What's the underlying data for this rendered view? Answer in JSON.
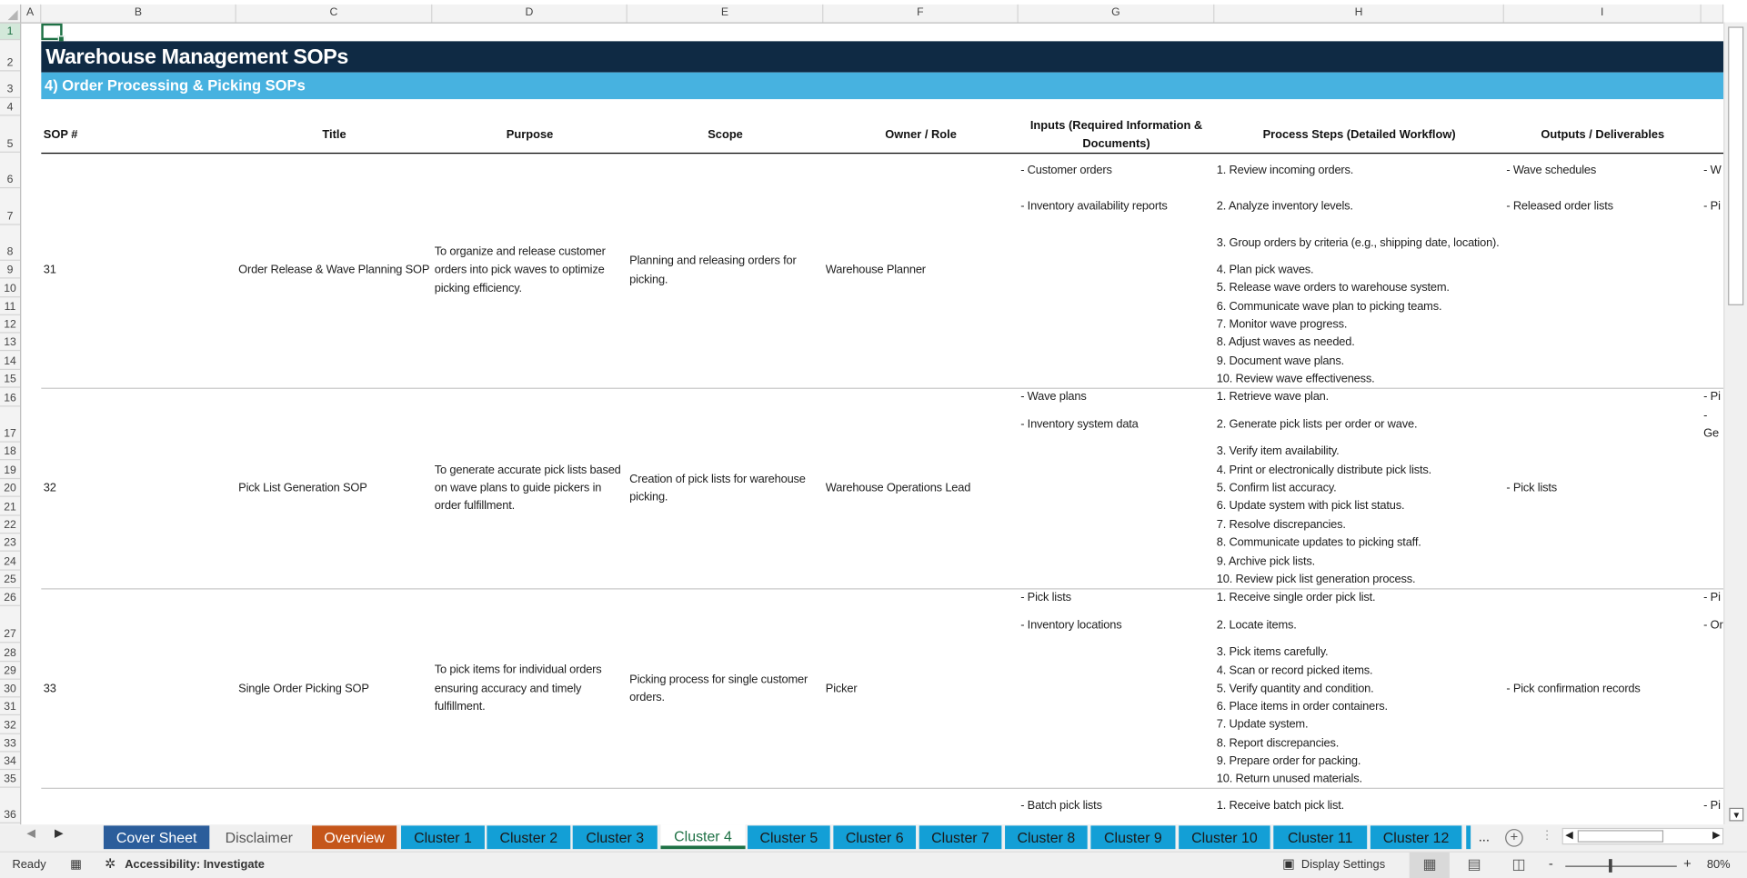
{
  "columns": [
    "A",
    "B",
    "C",
    "D",
    "E",
    "F",
    "G",
    "H",
    "I"
  ],
  "row_numbers": [
    1,
    2,
    3,
    4,
    5,
    6,
    7,
    8,
    9,
    10,
    11,
    12,
    13,
    14,
    15,
    16,
    17,
    18,
    19,
    20,
    21,
    22,
    23,
    24,
    25,
    26,
    27,
    28,
    29,
    30,
    31,
    32,
    33,
    34,
    35,
    36
  ],
  "sheet": {
    "title": "Warehouse Management SOPs",
    "subtitle": "4) Order Processing & Picking SOPs"
  },
  "headers": {
    "sop": "SOP #",
    "title": "Title",
    "purpose": "Purpose",
    "scope": "Scope",
    "owner": "Owner / Role",
    "inputs": "Inputs (Required Information & Documents)",
    "steps": "Process Steps (Detailed Workflow)",
    "outputs": "Outputs / Deliverables"
  },
  "sops": [
    {
      "number": "31",
      "title": "Order Release & Wave Planning SOP",
      "purpose": "To organize and release customer orders into pick waves to optimize picking efficiency.",
      "scope": "Planning and releasing orders for picking.",
      "owner": "Warehouse Planner",
      "inputs": [
        "- Customer orders",
        "- Inventory availability reports"
      ],
      "steps": [
        "1. Review incoming orders.",
        "2. Analyze inventory levels.",
        "3. Group orders by criteria (e.g., shipping date, location).",
        "4. Plan pick waves.",
        "5. Release wave orders to warehouse system.",
        "6. Communicate wave plan to picking teams.",
        "7. Monitor wave progress.",
        "8. Adjust waves as needed.",
        "9. Document wave plans.",
        "10. Review wave effectiveness."
      ],
      "outputs": [
        "- Wave schedules",
        "- Released order lists"
      ],
      "next_col": [
        "- W",
        "- Pi"
      ]
    },
    {
      "number": "32",
      "title": "Pick List Generation SOP",
      "purpose": "To generate accurate pick lists based on wave plans to guide pickers in order fulfillment.",
      "scope": "Creation of pick lists for warehouse picking.",
      "owner": "Warehouse Operations Lead",
      "inputs": [
        "- Wave plans",
        "- Inventory system data"
      ],
      "steps": [
        "1. Retrieve wave plan.",
        "2. Generate pick lists per order or wave.",
        "3. Verify item availability.",
        "4. Print or electronically distribute pick lists.",
        "5. Confirm list accuracy.",
        "6. Update system with pick list status.",
        "7. Resolve discrepancies.",
        "8. Communicate updates to picking staff.",
        "9. Archive pick lists.",
        "10. Review pick list generation process."
      ],
      "outputs": [
        "- Pick lists"
      ],
      "next_col": [
        "- Pi",
        "- Ge"
      ]
    },
    {
      "number": "33",
      "title": "Single Order Picking SOP",
      "purpose": "To pick items for individual orders ensuring accuracy and timely fulfillment.",
      "scope": "Picking process for single customer orders.",
      "owner": "Picker",
      "inputs": [
        "- Pick lists",
        "- Inventory locations"
      ],
      "steps": [
        "1. Receive single order pick list.",
        "2. Locate items.",
        "3. Pick items carefully.",
        "4. Scan or record picked items.",
        "5. Verify quantity and condition.",
        "6. Place items in order containers.",
        "7. Update system.",
        "8. Report discrepancies.",
        "9. Prepare order for packing.",
        "10. Return unused materials."
      ],
      "outputs": [
        "- Pick confirmation records"
      ],
      "next_col": [
        "- Pi",
        "- Or"
      ]
    },
    {
      "inputs": [
        "- Batch pick lists"
      ],
      "steps": [
        "1. Receive batch pick list."
      ],
      "next_col": [
        "- Pi"
      ]
    }
  ],
  "tabs": [
    {
      "label": "Cover Sheet",
      "color": "#2b5d9b",
      "text": "#ffffff"
    },
    {
      "label": "Disclaimer",
      "color": "#f0f0f0",
      "text": "#555555"
    },
    {
      "label": "Overview",
      "color": "#c5561a",
      "text": "#ffffff"
    },
    {
      "label": "Cluster 1",
      "color": "#139fd6",
      "text": "#1a1a1a"
    },
    {
      "label": "Cluster 2",
      "color": "#139fd6",
      "text": "#1a1a1a"
    },
    {
      "label": "Cluster 3",
      "color": "#139fd6",
      "text": "#1a1a1a"
    },
    {
      "label": "Cluster 4",
      "color": "#ffffff",
      "text": "#1e7145",
      "active": true
    },
    {
      "label": "Cluster 5",
      "color": "#139fd6",
      "text": "#1a1a1a"
    },
    {
      "label": "Cluster 6",
      "color": "#139fd6",
      "text": "#1a1a1a"
    },
    {
      "label": "Cluster 7",
      "color": "#139fd6",
      "text": "#1a1a1a"
    },
    {
      "label": "Cluster 8",
      "color": "#139fd6",
      "text": "#1a1a1a"
    },
    {
      "label": "Cluster 9",
      "color": "#139fd6",
      "text": "#1a1a1a"
    },
    {
      "label": "Cluster 10",
      "color": "#139fd6",
      "text": "#1a1a1a"
    },
    {
      "label": "Cluster 11",
      "color": "#139fd6",
      "text": "#1a1a1a"
    },
    {
      "label": "Cluster 12",
      "color": "#139fd6",
      "text": "#1a1a1a"
    }
  ],
  "tab_more": "...",
  "status": {
    "ready": "Ready",
    "accessibility": "Accessibility: Investigate",
    "display_settings": "Display Settings",
    "zoom": "80%",
    "zoom_minus": "-",
    "zoom_plus": "+",
    "zoom_level_percent": 80
  },
  "colors": {
    "title_bg": "#0f2a44",
    "subtitle_bg": "#47b2e0",
    "selection": "#1e7145"
  }
}
